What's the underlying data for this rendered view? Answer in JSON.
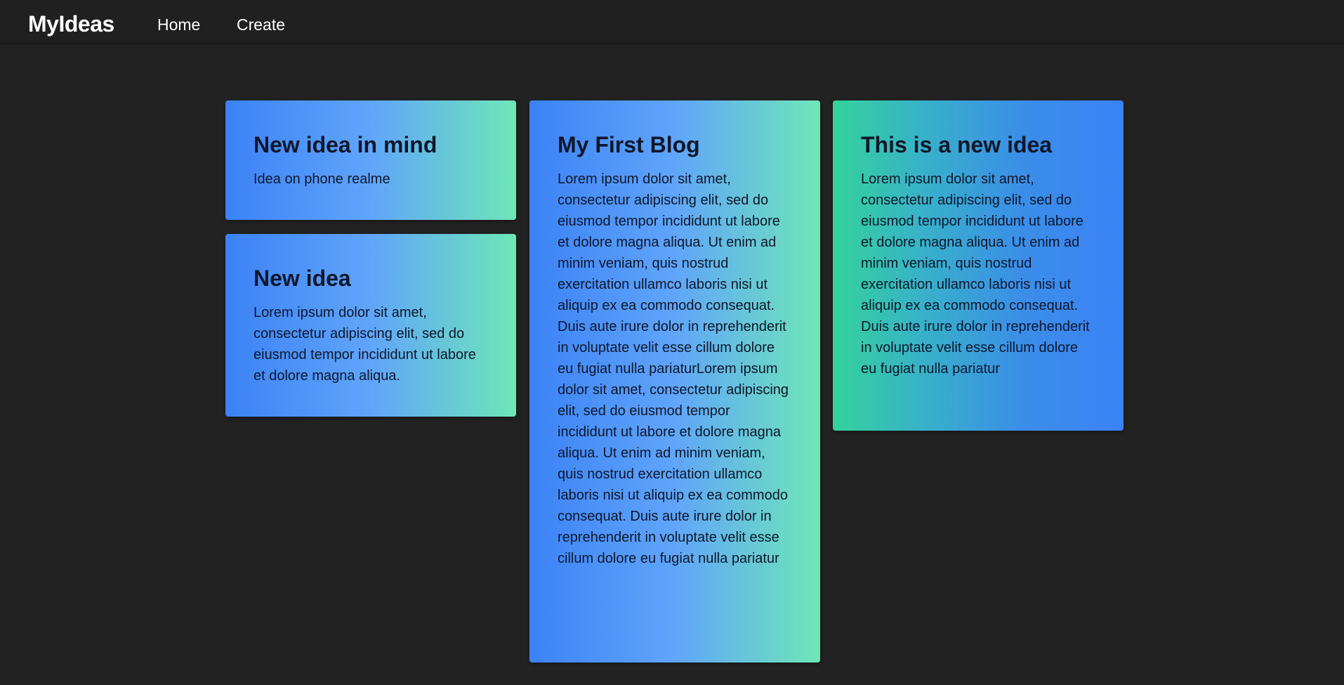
{
  "navbar": {
    "brand": "MyIdeas",
    "links": [
      {
        "label": "Home"
      },
      {
        "label": "Create"
      }
    ]
  },
  "ideas": [
    {
      "title": "New idea in mind",
      "body": "Idea on phone realme"
    },
    {
      "title": "New idea",
      "body": "Lorem ipsum dolor sit amet, consectetur adipiscing elit, sed do eiusmod tempor incididunt ut labore et dolore magna aliqua."
    },
    {
      "title": "My First Blog",
      "body": "Lorem ipsum dolor sit amet, consectetur adipiscing elit, sed do eiusmod tempor incididunt ut labore et dolore magna aliqua. Ut enim ad minim veniam, quis nostrud exercitation ullamco laboris nisi ut aliquip ex ea commodo consequat. Duis aute irure dolor in reprehenderit in voluptate velit esse cillum dolore eu fugiat nulla pariaturLorem ipsum dolor sit amet, consectetur adipiscing elit, sed do eiusmod tempor incididunt ut labore et dolore magna aliqua. Ut enim ad minim veniam, quis nostrud exercitation ullamco laboris nisi ut aliquip ex ea commodo consequat. Duis aute irure dolor in reprehenderit in voluptate velit esse cillum dolore eu fugiat nulla pariatur"
    },
    {
      "title": "This is a new idea",
      "body": "Lorem ipsum dolor sit amet, consectetur adipiscing elit, sed do eiusmod tempor incididunt ut labore et dolore magna aliqua. Ut enim ad minim veniam, quis nostrud exercitation ullamco laboris nisi ut aliquip ex ea commodo consequat. Duis aute irure dolor in reprehenderit in voluptate velit esse cillum dolore eu fugiat nulla pariatur"
    }
  ],
  "colors": {
    "page_background": "#222222",
    "navbar_background": "#202020",
    "gradient_blue": "#3b82f6",
    "gradient_light_blue": "#60a5fa",
    "gradient_mint": "#6ee7b7",
    "gradient_green": "#34d399",
    "text_dark": "#0f172a",
    "nav_text": "#ffffff"
  }
}
